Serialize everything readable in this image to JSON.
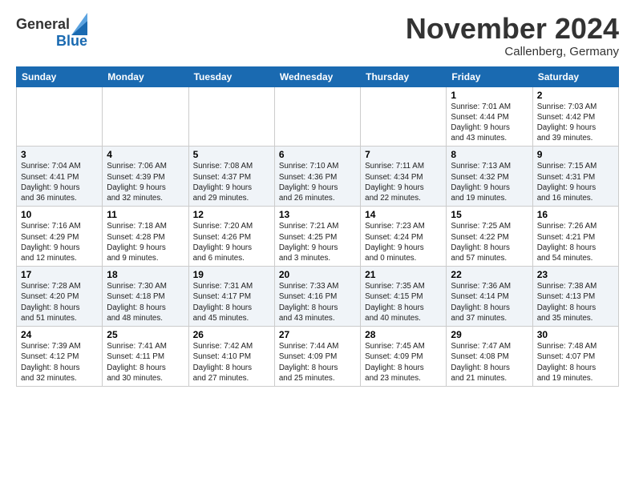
{
  "header": {
    "logo_general": "General",
    "logo_blue": "Blue",
    "month_title": "November 2024",
    "location": "Callenberg, Germany"
  },
  "weekdays": [
    "Sunday",
    "Monday",
    "Tuesday",
    "Wednesday",
    "Thursday",
    "Friday",
    "Saturday"
  ],
  "weeks": [
    [
      {
        "day": "",
        "info": ""
      },
      {
        "day": "",
        "info": ""
      },
      {
        "day": "",
        "info": ""
      },
      {
        "day": "",
        "info": ""
      },
      {
        "day": "",
        "info": ""
      },
      {
        "day": "1",
        "info": "Sunrise: 7:01 AM\nSunset: 4:44 PM\nDaylight: 9 hours\nand 43 minutes."
      },
      {
        "day": "2",
        "info": "Sunrise: 7:03 AM\nSunset: 4:42 PM\nDaylight: 9 hours\nand 39 minutes."
      }
    ],
    [
      {
        "day": "3",
        "info": "Sunrise: 7:04 AM\nSunset: 4:41 PM\nDaylight: 9 hours\nand 36 minutes."
      },
      {
        "day": "4",
        "info": "Sunrise: 7:06 AM\nSunset: 4:39 PM\nDaylight: 9 hours\nand 32 minutes."
      },
      {
        "day": "5",
        "info": "Sunrise: 7:08 AM\nSunset: 4:37 PM\nDaylight: 9 hours\nand 29 minutes."
      },
      {
        "day": "6",
        "info": "Sunrise: 7:10 AM\nSunset: 4:36 PM\nDaylight: 9 hours\nand 26 minutes."
      },
      {
        "day": "7",
        "info": "Sunrise: 7:11 AM\nSunset: 4:34 PM\nDaylight: 9 hours\nand 22 minutes."
      },
      {
        "day": "8",
        "info": "Sunrise: 7:13 AM\nSunset: 4:32 PM\nDaylight: 9 hours\nand 19 minutes."
      },
      {
        "day": "9",
        "info": "Sunrise: 7:15 AM\nSunset: 4:31 PM\nDaylight: 9 hours\nand 16 minutes."
      }
    ],
    [
      {
        "day": "10",
        "info": "Sunrise: 7:16 AM\nSunset: 4:29 PM\nDaylight: 9 hours\nand 12 minutes."
      },
      {
        "day": "11",
        "info": "Sunrise: 7:18 AM\nSunset: 4:28 PM\nDaylight: 9 hours\nand 9 minutes."
      },
      {
        "day": "12",
        "info": "Sunrise: 7:20 AM\nSunset: 4:26 PM\nDaylight: 9 hours\nand 6 minutes."
      },
      {
        "day": "13",
        "info": "Sunrise: 7:21 AM\nSunset: 4:25 PM\nDaylight: 9 hours\nand 3 minutes."
      },
      {
        "day": "14",
        "info": "Sunrise: 7:23 AM\nSunset: 4:24 PM\nDaylight: 9 hours\nand 0 minutes."
      },
      {
        "day": "15",
        "info": "Sunrise: 7:25 AM\nSunset: 4:22 PM\nDaylight: 8 hours\nand 57 minutes."
      },
      {
        "day": "16",
        "info": "Sunrise: 7:26 AM\nSunset: 4:21 PM\nDaylight: 8 hours\nand 54 minutes."
      }
    ],
    [
      {
        "day": "17",
        "info": "Sunrise: 7:28 AM\nSunset: 4:20 PM\nDaylight: 8 hours\nand 51 minutes."
      },
      {
        "day": "18",
        "info": "Sunrise: 7:30 AM\nSunset: 4:18 PM\nDaylight: 8 hours\nand 48 minutes."
      },
      {
        "day": "19",
        "info": "Sunrise: 7:31 AM\nSunset: 4:17 PM\nDaylight: 8 hours\nand 45 minutes."
      },
      {
        "day": "20",
        "info": "Sunrise: 7:33 AM\nSunset: 4:16 PM\nDaylight: 8 hours\nand 43 minutes."
      },
      {
        "day": "21",
        "info": "Sunrise: 7:35 AM\nSunset: 4:15 PM\nDaylight: 8 hours\nand 40 minutes."
      },
      {
        "day": "22",
        "info": "Sunrise: 7:36 AM\nSunset: 4:14 PM\nDaylight: 8 hours\nand 37 minutes."
      },
      {
        "day": "23",
        "info": "Sunrise: 7:38 AM\nSunset: 4:13 PM\nDaylight: 8 hours\nand 35 minutes."
      }
    ],
    [
      {
        "day": "24",
        "info": "Sunrise: 7:39 AM\nSunset: 4:12 PM\nDaylight: 8 hours\nand 32 minutes."
      },
      {
        "day": "25",
        "info": "Sunrise: 7:41 AM\nSunset: 4:11 PM\nDaylight: 8 hours\nand 30 minutes."
      },
      {
        "day": "26",
        "info": "Sunrise: 7:42 AM\nSunset: 4:10 PM\nDaylight: 8 hours\nand 27 minutes."
      },
      {
        "day": "27",
        "info": "Sunrise: 7:44 AM\nSunset: 4:09 PM\nDaylight: 8 hours\nand 25 minutes."
      },
      {
        "day": "28",
        "info": "Sunrise: 7:45 AM\nSunset: 4:09 PM\nDaylight: 8 hours\nand 23 minutes."
      },
      {
        "day": "29",
        "info": "Sunrise: 7:47 AM\nSunset: 4:08 PM\nDaylight: 8 hours\nand 21 minutes."
      },
      {
        "day": "30",
        "info": "Sunrise: 7:48 AM\nSunset: 4:07 PM\nDaylight: 8 hours\nand 19 minutes."
      }
    ]
  ]
}
